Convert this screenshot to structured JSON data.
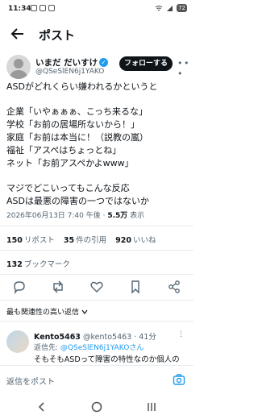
{
  "status": {
    "time": "11:34",
    "battery": "72"
  },
  "header": {
    "title": "ポスト"
  },
  "author": {
    "name": "いまだ だいすけ",
    "handle": "@QSeSlEN6j1YAKO",
    "follow_label": "フォローする"
  },
  "tweet": {
    "lines": [
      "ASDがどれくらい嫌われるかというと",
      "",
      "企業「いやぁぁぁ、こっち来るな」",
      "学校「お前の居場所ないから！」",
      "家庭「お前は本当に！（説教の嵐）",
      "福祉「アスペはちょっとね」",
      "ネット「お前アスペかよwww」",
      "",
      "マジでどこいってもこんな反応",
      "ASDは最悪の障害の一つではないか"
    ],
    "datetime": "2026年06月13日 7:40 午後",
    "views_count": "5.5万",
    "views_label": "表示"
  },
  "stats": {
    "reposts_count": "150",
    "reposts_label": "リポスト",
    "quotes_count": "35",
    "quotes_label": "件の引用",
    "likes_count": "920",
    "likes_label": "いいね",
    "bookmarks_count": "132",
    "bookmarks_label": "ブックマーク"
  },
  "replies_sort": "最も関連性の高い返信",
  "reply": {
    "name": "Kento5463",
    "handle": "@kento5463",
    "time": "41分",
    "reply_to_label": "返信先: ",
    "reply_to_handle": "@QSeSlEN6j1YAKOさん",
    "text": "そもそもASDって障害の特性なのか個人の"
  },
  "reply_box": {
    "placeholder": "返信をポスト"
  },
  "colors": {
    "accent": "#1d9bf0",
    "text": "#0f1419",
    "muted": "#536471"
  },
  "icons": [
    "back-arrow-icon",
    "verified-badge-icon",
    "more-icon",
    "reply-icon",
    "repost-icon",
    "like-icon",
    "bookmark-icon",
    "share-icon",
    "camera-icon",
    "nav-back-icon",
    "nav-home-icon",
    "nav-recents-icon"
  ]
}
